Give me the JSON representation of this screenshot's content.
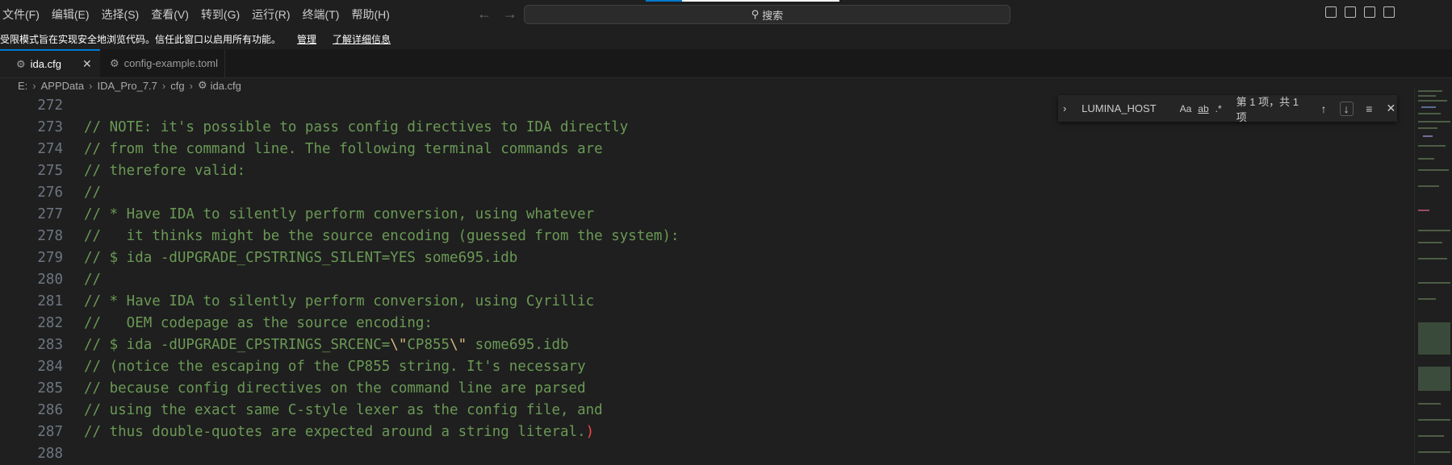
{
  "menu": [
    "文件(F)",
    "编辑(E)",
    "选择(S)",
    "查看(V)",
    "转到(G)",
    "运行(R)",
    "终端(T)",
    "帮助(H)"
  ],
  "search": {
    "label": "搜索"
  },
  "restricted": {
    "message": "受限模式旨在实现安全地浏览代码。信任此窗口以启用所有功能。",
    "manage": "管理",
    "learn_more": "了解详细信息"
  },
  "tabs": [
    {
      "label": "ida.cfg",
      "active": true
    },
    {
      "label": "config-example.toml",
      "active": false
    }
  ],
  "breadcrumb": [
    "E:",
    "APPData",
    "IDA_Pro_7.7",
    "cfg",
    "ida.cfg"
  ],
  "find": {
    "query": "LUMINA_HOST",
    "match_case": "Aa",
    "whole_word": "ab",
    "regex": ".*",
    "count": "第 1 项，共 1 项"
  },
  "lines": [
    {
      "n": "272",
      "text": ""
    },
    {
      "n": "273",
      "text": "// NOTE: it's possible to pass config directives to IDA directly"
    },
    {
      "n": "274",
      "text": "// from the command line. The following terminal commands are"
    },
    {
      "n": "275",
      "text": "// therefore valid:"
    },
    {
      "n": "276",
      "text": "//"
    },
    {
      "n": "277",
      "text": "// * Have IDA to silently perform conversion, using whatever"
    },
    {
      "n": "278",
      "text": "//   it thinks might be the source encoding (guessed from the system):"
    },
    {
      "n": "279",
      "text": "// $ ida -dUPGRADE_CPSTRINGS_SILENT=YES some695.idb"
    },
    {
      "n": "280",
      "text": "//"
    },
    {
      "n": "281",
      "text": "// * Have IDA to silently perform conversion, using Cyrillic"
    },
    {
      "n": "282",
      "text": "//   OEM codepage as the source encoding:"
    },
    {
      "n": "283",
      "text": "// $ ida -dUPGRADE_CPSTRINGS_SRCENC=",
      "esc1": "\\\"",
      "mid": "CP855",
      "esc2": "\\\"",
      "tail": " some695.idb"
    },
    {
      "n": "284",
      "text": "// (notice the escaping of the CP855 string. It's necessary"
    },
    {
      "n": "285",
      "text": "// because config directives on the command line are parsed"
    },
    {
      "n": "286",
      "text": "// using the exact same C-style lexer as the config file, and"
    },
    {
      "n": "287",
      "text": "// thus double-quotes are expected around a string literal.",
      "paren": ")"
    },
    {
      "n": "288",
      "text": ""
    }
  ]
}
